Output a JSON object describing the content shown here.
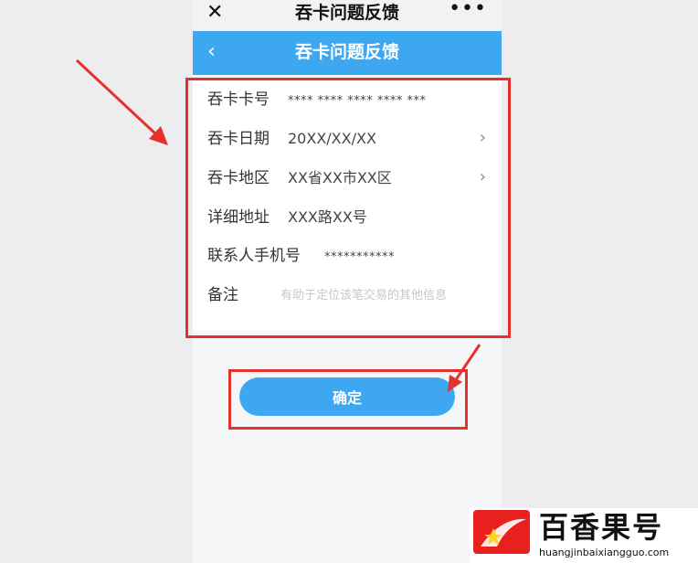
{
  "wechat_bar": {
    "close_icon": "close-icon",
    "title": "吞卡问题反馈",
    "more_icon": "more-icon"
  },
  "header": {
    "back_icon": "chevron-left-icon",
    "title": "吞卡问题反馈",
    "color": "#3ea7f2"
  },
  "form": {
    "fields": [
      {
        "label": "吞卡卡号",
        "value": "**** **** **** **** ***"
      },
      {
        "label": "吞卡日期",
        "value": "20XX/XX/XX"
      },
      {
        "label": "吞卡地区",
        "value": "XX省XX市XX区"
      },
      {
        "label": "详细地址",
        "value": "XXX路XX号"
      },
      {
        "label": "联系人手机号",
        "value": "***********"
      },
      {
        "label": "备注",
        "placeholder": "有助于定位该笔交易的其他信息"
      }
    ]
  },
  "confirm_button": {
    "label": "确定"
  },
  "annotations": {
    "highlight_color": "#e6302c"
  },
  "watermark": {
    "logo_icon": "star-logo-icon",
    "text": "百香果号",
    "url": "huangjinbaixiangguo.com"
  }
}
